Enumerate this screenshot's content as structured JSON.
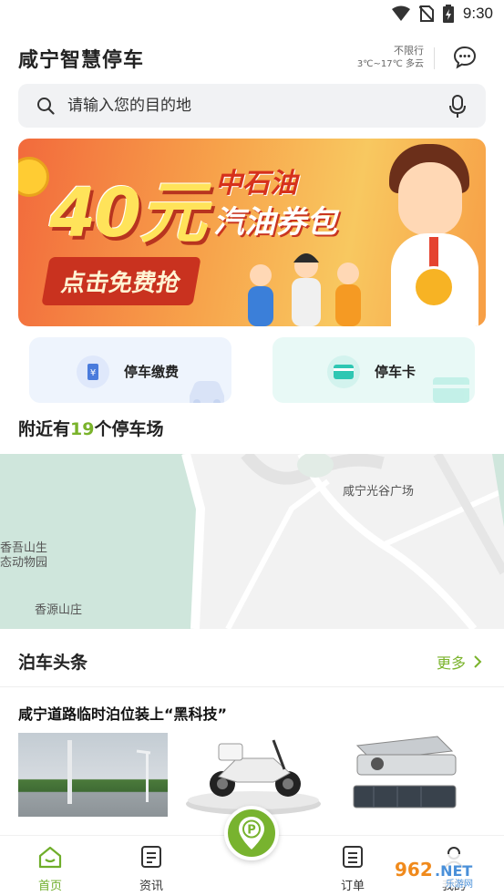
{
  "status_bar": {
    "time": "9:30"
  },
  "header": {
    "title": "咸宁智慧停车",
    "restriction": "不限行",
    "weather": "3℃~17℃ 多云"
  },
  "search": {
    "placeholder": "请输入您的目的地"
  },
  "banner": {
    "amount": "40元",
    "brand": "中石油",
    "subtitle": "汽油券包",
    "cta": "点击免费抢"
  },
  "quick_actions": [
    {
      "label": "停车缴费",
      "icon": "yuan-card-icon"
    },
    {
      "label": "停车卡",
      "icon": "card-icon"
    }
  ],
  "nearby": {
    "prefix": "附近有",
    "count": "19",
    "suffix": "个停车场"
  },
  "map": {
    "labels": [
      "咸宁光谷广场",
      "香吾山生",
      "态动物园",
      "香源山庄"
    ]
  },
  "news": {
    "title": "泊车头条",
    "more": "更多",
    "article_title": "咸宁道路临时泊位装上“黑科技”"
  },
  "tabbar": {
    "items": [
      {
        "label": "首页",
        "icon": "home-icon"
      },
      {
        "label": "资讯",
        "icon": "news-icon"
      },
      {
        "label": "订单",
        "icon": "order-icon"
      },
      {
        "label": "我的",
        "icon": "user-icon"
      }
    ],
    "center_icon": "parking-location-icon"
  },
  "watermark": "962.NET 乐游网",
  "colors": {
    "accent": "#78b32f",
    "accent_text": "#7ab32b",
    "banner": "#f26a3c"
  }
}
